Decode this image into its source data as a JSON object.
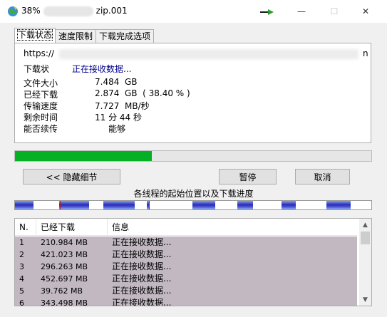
{
  "window": {
    "title_prefix": "38%",
    "title_suffix": "zip.001",
    "minimize_glyph": "—",
    "maximize_glyph": "☐",
    "close_glyph": "✕"
  },
  "tabs": [
    {
      "label": "下载状态",
      "active": true
    },
    {
      "label": "速度限制",
      "active": false
    },
    {
      "label": "下载完成选项",
      "active": false
    }
  ],
  "status": {
    "url_prefix": "https://",
    "url_tail": "n",
    "status_label": "下载状",
    "status_value": "正在接收数据...",
    "info": [
      {
        "label": "文件大小",
        "value": "7.484  GB"
      },
      {
        "label": "已经下载",
        "value": "2.874  GB  ( 38.40 % )"
      },
      {
        "label": "传输速度",
        "value": "7.727  MB/秒"
      },
      {
        "label": "剩余时间",
        "value": "11 分 44 秒"
      },
      {
        "label": "能否续传",
        "value": "     能够"
      }
    ]
  },
  "progress": {
    "percent": 38.4
  },
  "buttons": {
    "hide_details": "<< 隐藏细节",
    "pause": "暂停",
    "cancel": "取消"
  },
  "segments": {
    "caption": "各线程的起始位置以及下载进度",
    "color": "#2b2bb8"
  },
  "connections": {
    "headers": [
      "N.",
      "已经下载",
      "信息"
    ],
    "rows": [
      {
        "n": "1",
        "downloaded": "210.984  MB",
        "info": "正在接收数据..."
      },
      {
        "n": "2",
        "downloaded": "421.023  MB",
        "info": "正在接收数据..."
      },
      {
        "n": "3",
        "downloaded": "296.263  MB",
        "info": "正在接收数据..."
      },
      {
        "n": "4",
        "downloaded": "452.697  MB",
        "info": "正在接收数据..."
      },
      {
        "n": "5",
        "downloaded": "39.762  MB",
        "info": "正在接收数据..."
      },
      {
        "n": "6",
        "downloaded": "343.498  MB",
        "info": "正在接收数据..."
      }
    ],
    "row_color": "#c1b8c1"
  }
}
